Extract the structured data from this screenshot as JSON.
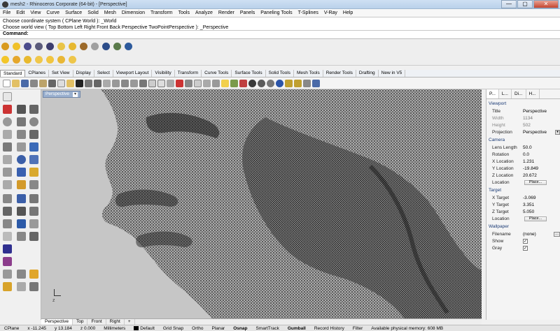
{
  "window": {
    "title": "mesh2 - Rhinoceros Corporate (64-bit) - [Perspective]",
    "minimize": "—",
    "maximize": "▢",
    "close": "✕"
  },
  "menu": [
    "File",
    "Edit",
    "View",
    "Curve",
    "Surface",
    "Solid",
    "Mesh",
    "Dimension",
    "Transform",
    "Tools",
    "Analyze",
    "Render",
    "Panels",
    "Paneling Tools",
    "T-Splines",
    "V-Ray",
    "Help"
  ],
  "command_history": [
    "Choose coordinate system ( CPlane  World ): _World",
    "Choose world view ( Top  Bottom  Left  Right  Front  Back  Perspective  TwoPointPerspective ): _Perspective"
  ],
  "command_prompt": {
    "label": "Command:",
    "value": ""
  },
  "toolbar_tabs": [
    "Standard",
    "CPlanes",
    "Set View",
    "Display",
    "Select",
    "Viewport Layout",
    "Visibility",
    "Transform",
    "Curve Tools",
    "Surface Tools",
    "Solid Tools",
    "Mesh Tools",
    "Render Tools",
    "Drafting",
    "New in V5"
  ],
  "active_toolbar_tab": "Standard",
  "viewport": {
    "name": "Perspective",
    "bottom_tabs": [
      "Perspective",
      "Top",
      "Front",
      "Right"
    ],
    "add_tab": "+",
    "axis_label": "z"
  },
  "panel": {
    "tabs": [
      {
        "label": "P...",
        "icon": "properties-icon"
      },
      {
        "label": "L...",
        "icon": "layers-icon"
      },
      {
        "label": "Di...",
        "icon": "display-icon"
      },
      {
        "label": "H...",
        "icon": "help-icon"
      }
    ],
    "viewport_section": "Viewport",
    "viewport_rows": [
      {
        "key": "Title",
        "value": "Perspective",
        "gray": false
      },
      {
        "key": "Width",
        "value": "1134",
        "gray": true
      },
      {
        "key": "Height",
        "value": "502",
        "gray": true
      },
      {
        "key": "Projection",
        "value": "Perspective",
        "gray": false
      }
    ],
    "camera_section": "Camera",
    "camera_rows": [
      {
        "key": "Lens Length",
        "value": "50.0"
      },
      {
        "key": "Rotation",
        "value": "0.0"
      },
      {
        "key": "X Location",
        "value": "1.231"
      },
      {
        "key": "Y Location",
        "value": "-19.849"
      },
      {
        "key": "Z Location",
        "value": "20.672"
      }
    ],
    "location_label": "Location",
    "place_button": "Place...",
    "target_section": "Target",
    "target_rows": [
      {
        "key": "X Target",
        "value": "-3.069"
      },
      {
        "key": "Y Target",
        "value": "3.351"
      },
      {
        "key": "Z Target",
        "value": "5.050"
      }
    ],
    "wallpaper_section": "Wallpaper",
    "wallpaper_rows": [
      {
        "key": "Filename",
        "value": "(none)"
      },
      {
        "key": "Show",
        "value": "✓"
      },
      {
        "key": "Gray",
        "value": "✓"
      }
    ]
  },
  "status": {
    "cplane": "CPlane",
    "x": "x -11.245",
    "y": "y 13.184",
    "z": "z 0.000",
    "units": "Millimeters",
    "layer": "Default",
    "toggles": [
      "Grid Snap",
      "Ortho",
      "Planar",
      "Osnap",
      "SmartTrack",
      "Gumball",
      "Record History",
      "Filter"
    ],
    "memory": "Available physical memory: 608 MB"
  }
}
